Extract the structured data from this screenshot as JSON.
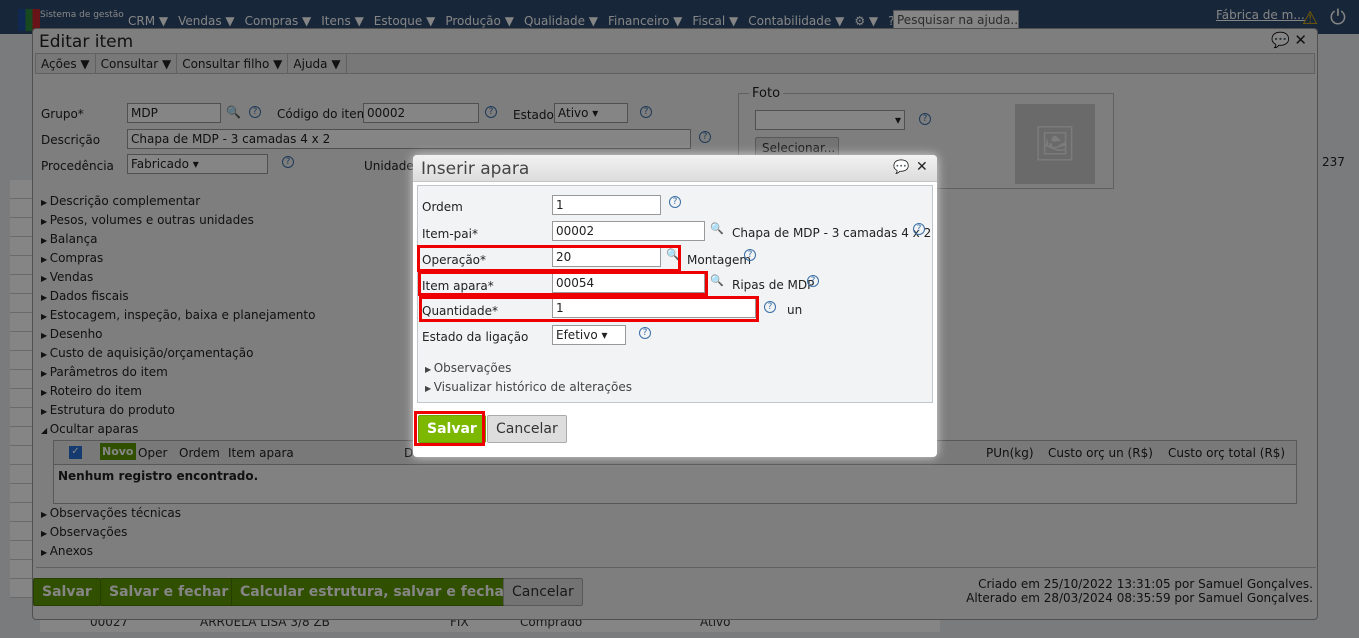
{
  "topbar": {
    "brand": "Sistema de gestão",
    "menu": [
      "CRM ▼",
      "Vendas ▼",
      "Compras ▼",
      "Itens ▼",
      "Estoque ▼",
      "Produção ▼",
      "Qualidade ▼",
      "Financeiro ▼",
      "Fiscal ▼",
      "Contabilidade ▼",
      "⚙ ▼",
      "? ▼"
    ],
    "search_placeholder": "Pesquisar na ajuda...",
    "company": "Fábrica de m...",
    "count": "237"
  },
  "background_row": {
    "code": "00027",
    "description": "ARRUELA LISA 3/8 ZB",
    "unit": "FIX",
    "procedence": "Comprado",
    "state": "Ativo"
  },
  "edit": {
    "title": "Editar item",
    "menu": [
      "Ações ▼",
      "Consultar ▼",
      "Consultar filho ▼",
      "Ajuda ▼"
    ],
    "group_label": "Grupo*",
    "group_value": "MDP",
    "code_label": "Código do item",
    "code_value": "00002",
    "state_label": "Estado",
    "state_value": "Ativo",
    "description_label": "Descrição",
    "description_value": "Chapa de MDP - 3 camadas 4 x 2",
    "procedence_label": "Procedência",
    "procedence_value": "Fabricado",
    "unit_label": "Unidade",
    "photo_label": "Foto",
    "photo_select_button": "Selecionar...",
    "sections": [
      "Descrição complementar",
      "Pesos, volumes e outras unidades",
      "Balança",
      "Compras",
      "Vendas",
      "Dados fiscais",
      "Estocagem, inspeção, baixa e planejamento",
      "Desenho",
      "Custo de aquisição/orçamentação",
      "Parâmetros do item",
      "Roteiro do item",
      "Estrutura do produto"
    ],
    "open_section": "Ocultar aparas",
    "table": {
      "new_button": "Novo",
      "columns": [
        "Oper",
        "Ordem",
        "Item apara",
        "D",
        "PUn(kg)",
        "Custo orç un (R$)",
        "Custo orç total (R$)"
      ],
      "empty": "Nenhum registro encontrado."
    },
    "sections_after": [
      "Observações técnicas",
      "Observações",
      "Anexos"
    ],
    "buttons": {
      "save": "Salvar",
      "save_close": "Salvar e fechar",
      "calc": "Calcular estrutura, salvar e fechar",
      "cancel": "Cancelar"
    },
    "created": "Criado em 25/10/2022 13:31:05 por Samuel Gonçalves.",
    "modified": "Alterado em 28/03/2024 08:35:59 por Samuel Gonçalves."
  },
  "modal": {
    "title": "Inserir apara",
    "ordem_label": "Ordem",
    "ordem_value": "1",
    "parent_label": "Item-pai*",
    "parent_value": "00002",
    "parent_desc": "Chapa de MDP - 3 camadas 4 x 2",
    "op_label": "Operação*",
    "op_value": "20",
    "op_desc": "Montagem",
    "scrap_label": "Item apara*",
    "scrap_value": "00054",
    "scrap_desc": "Ripas de MDP",
    "qty_label": "Quantidade*",
    "qty_value": "1",
    "qty_unit": "un",
    "link_label": "Estado da ligação",
    "link_value": "Efetivo",
    "obs": "Observações",
    "history": "Visualizar histórico de alterações",
    "save": "Salvar",
    "cancel": "Cancelar"
  }
}
